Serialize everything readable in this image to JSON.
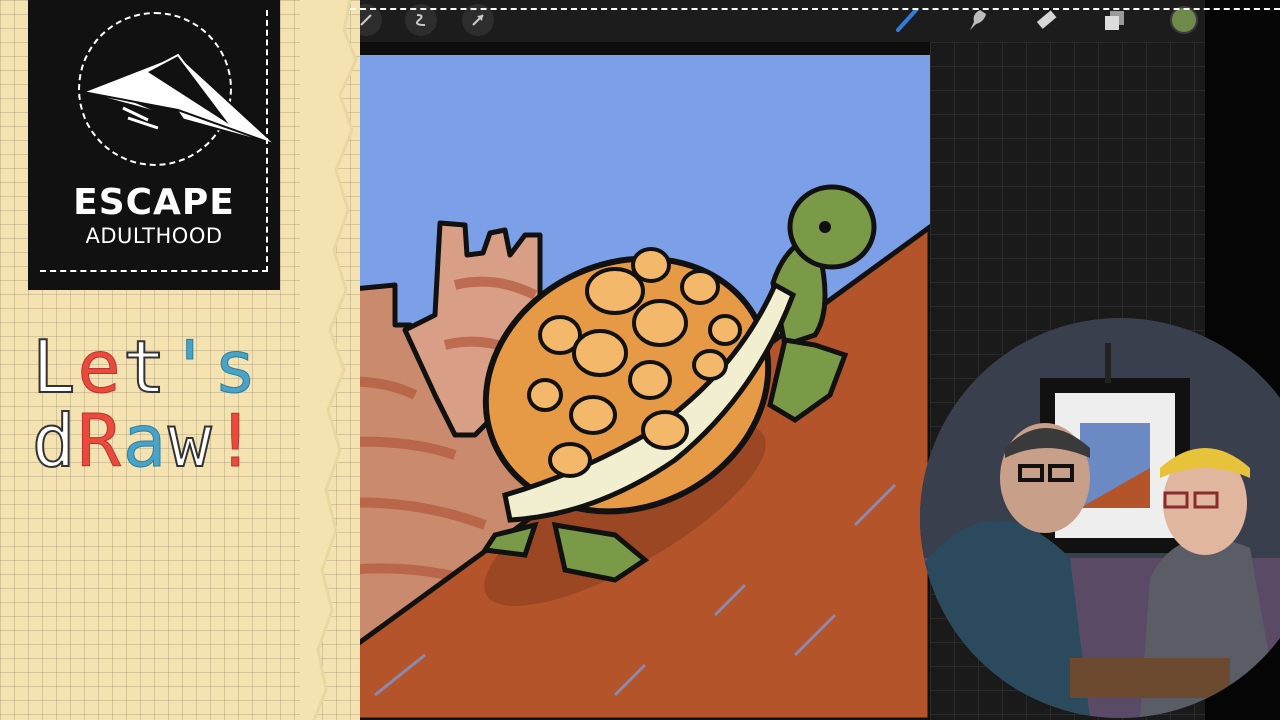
{
  "branding": {
    "title": "ESCAPE",
    "subtitle": "ADULTHOOD",
    "logo_icon": "paper-airplane-icon"
  },
  "banner": {
    "line1_parts": [
      "L",
      "e",
      "t",
      "'",
      "s"
    ],
    "line2_parts": [
      "d",
      "R",
      "a",
      "w",
      "!"
    ]
  },
  "toolbar": {
    "left_tools": [
      {
        "icon": "selection-icon"
      },
      {
        "icon": "adjust-icon"
      },
      {
        "icon": "move-icon"
      }
    ],
    "right_tools": [
      {
        "icon": "brush-icon",
        "active": true
      },
      {
        "icon": "smudge-icon"
      },
      {
        "icon": "eraser-icon"
      },
      {
        "icon": "layers-icon"
      },
      {
        "icon": "color-swatch-icon",
        "color": "#6e8a4a"
      }
    ]
  },
  "colors": {
    "sky": "#7ba0e8",
    "ground": "#b4542a",
    "mesa": "#c98a6e",
    "shell": "#e79a46",
    "shell_spot": "#f4b86a",
    "turtle_skin": "#7a9a48",
    "shell_rim": "#f1efcf",
    "accent_brush": "#2f7ddc"
  }
}
